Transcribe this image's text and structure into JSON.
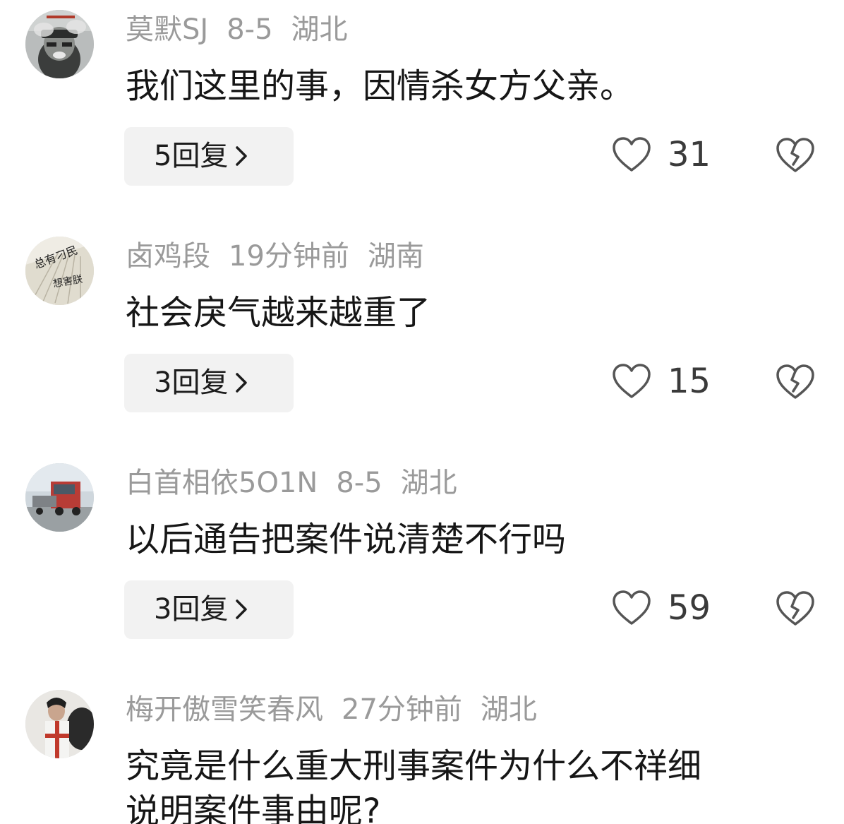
{
  "comments": [
    {
      "username": "莫默SJ",
      "date": "8-5",
      "location": "湖北",
      "text": "我们这里的事，因情杀女方父亲。",
      "reply_label": "5回复",
      "likes": "31"
    },
    {
      "username": "卤鸡段",
      "date": "19分钟前",
      "location": "湖南",
      "text": "社会戾气越来越重了",
      "reply_label": "3回复",
      "likes": "15"
    },
    {
      "username": "白首相依5O1N",
      "date": "8-5",
      "location": "湖北",
      "text": "以后通告把案件说清楚不行吗",
      "reply_label": "3回复",
      "likes": "59"
    },
    {
      "username": "梅开傲雪笑春风",
      "date": "27分钟前",
      "location": "湖北",
      "text": "究竟是什么重大刑事案件为什么不祥细",
      "text_line2": "说明案件事由呢?"
    }
  ],
  "icons": {
    "like": "heart-outline-icon",
    "dislike": "broken-heart-icon",
    "reply_arrow": "chevron-right-icon"
  },
  "colors": {
    "meta_text": "#9a9a9a",
    "body_text": "#161616",
    "reply_bg": "#f2f2f2",
    "icon_stroke": "#555555"
  }
}
